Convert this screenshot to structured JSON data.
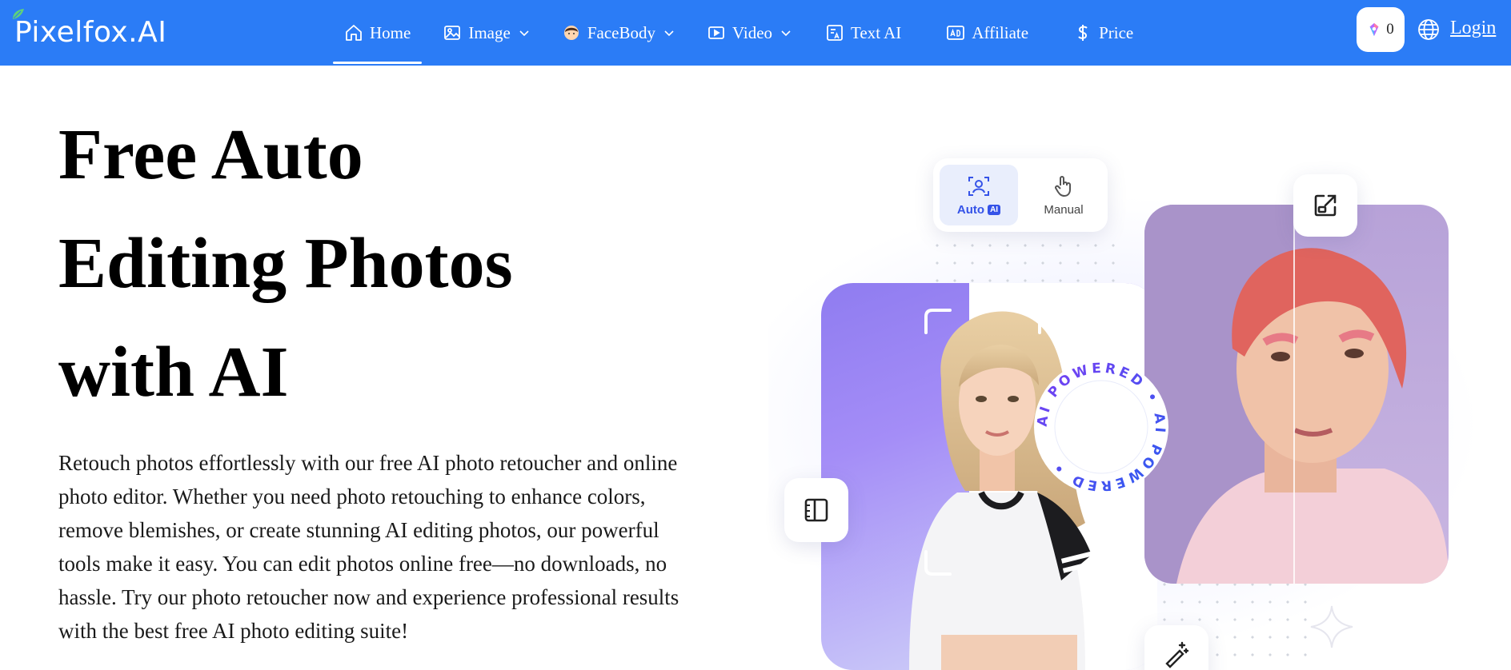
{
  "header": {
    "logo_text": "Pixelfox.AI",
    "nav": [
      {
        "label": "Home",
        "icon": "home-icon",
        "active": true,
        "dropdown": false
      },
      {
        "label": "Image",
        "icon": "image-icon",
        "dropdown": true
      },
      {
        "label": "FaceBody",
        "icon": "face-icon",
        "dropdown": true
      },
      {
        "label": "Video",
        "icon": "video-icon",
        "dropdown": true
      },
      {
        "label": "Text AI",
        "icon": "text-ai-icon",
        "dropdown": false
      },
      {
        "label": "Affiliate",
        "icon": "ad-icon",
        "dropdown": false
      },
      {
        "label": "Price",
        "icon": "dollar-icon",
        "dropdown": false
      }
    ],
    "credits": "0",
    "login_label": "Login"
  },
  "hero": {
    "title_lines": [
      "Free Auto",
      "Editing Photos",
      "with AI"
    ],
    "description_lines": [
      "Retouch photos effortlessly with our free AI photo retoucher and online",
      "photo editor. Whether you need photo retouching to enhance colors,",
      "remove blemishes, or create stunning AI editing photos, our powerful",
      "tools make it easy. You can edit photos online free—no downloads, no",
      "hassle. Try our photo retoucher now and experience professional results",
      "with the best free AI photo editing suite!"
    ]
  },
  "illustration": {
    "mode_auto_label": "Auto",
    "mode_auto_badge": "AI",
    "mode_manual_label": "Manual",
    "badge_text": "AI POWERED • AI POWERED • ",
    "colors": {
      "brand": "#2b7cf6",
      "accent_purple": "#7b3ff2",
      "badge_blue": "#3553e8"
    }
  }
}
